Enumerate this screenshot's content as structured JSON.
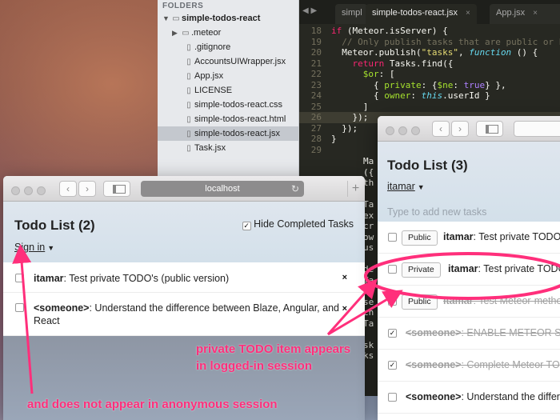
{
  "sidebar": {
    "header": "FOLDERS",
    "items": [
      {
        "label": "simple-todos-react",
        "type": "folder-open"
      },
      {
        "label": ".meteor",
        "type": "folder-closed"
      },
      {
        "label": ".gitignore",
        "type": "file"
      },
      {
        "label": "AccountsUIWrapper.jsx",
        "type": "file"
      },
      {
        "label": "App.jsx",
        "type": "file"
      },
      {
        "label": "LICENSE",
        "type": "file"
      },
      {
        "label": "simple-todos-react.css",
        "type": "file"
      },
      {
        "label": "simple-todos-react.html",
        "type": "file"
      },
      {
        "label": "simple-todos-react.jsx",
        "type": "file",
        "selected": true
      },
      {
        "label": "Task.jsx",
        "type": "file"
      }
    ]
  },
  "editor": {
    "tabs": [
      {
        "label": "simpl"
      },
      {
        "label": "simple-todos-react.jsx",
        "active": true
      },
      {
        "label": "App.jsx"
      }
    ],
    "close_glyph": "×",
    "lines": [
      {
        "n": "18",
        "code": "if (Meteor.isServer) {"
      },
      {
        "n": "19",
        "code": "  // Only publish tasks that are public or bel"
      },
      {
        "n": "20",
        "code": "  Meteor.publish(\"tasks\", function () {"
      },
      {
        "n": "21",
        "code": "    return Tasks.find({"
      },
      {
        "n": "22",
        "code": "      $or: ["
      },
      {
        "n": "23",
        "code": "        { private: {$ne: true} },"
      },
      {
        "n": "24",
        "code": "        { owner: this.userId }"
      },
      {
        "n": "25",
        "code": "      ]"
      },
      {
        "n": "26",
        "code": "    });"
      },
      {
        "n": "27",
        "code": "  });"
      },
      {
        "n": "28",
        "code": "}"
      },
      {
        "n": "29",
        "code": ""
      },
      {
        "n": "30",
        "code": "Meteor.meth"
      },
      {
        "n": "31",
        "code": "  addTask"
      }
    ],
    "fragments": [
      "Ma",
      "({",
      "th",
      "",
      "Ta",
      "ex",
      "cr",
      "ow",
      "us",
      "",
      "de",
      "Ta",
      "",
      "se",
      "ch",
      "Ta",
      "",
      "sk",
      "ks"
    ]
  },
  "left_window": {
    "url": "localhost",
    "title": "Todo List (2)",
    "login_label": "Sign in",
    "hide_completed_label": "Hide Completed Tasks",
    "hide_completed_checked": true,
    "tasks": [
      {
        "owner": "itamar",
        "text": ": Test private TODO's (public version)",
        "checked": false
      },
      {
        "owner": "<someone>",
        "text": ": Understand the difference between Blaze, Angular, and React",
        "checked": false
      }
    ],
    "delete_glyph": "×"
  },
  "right_window": {
    "title": "Todo List (3)",
    "login_label": "itamar",
    "new_task_placeholder": "Type to add new tasks",
    "tasks": [
      {
        "privacy_button": "Public",
        "owner": "itamar",
        "text": ": Test private TODO",
        "checked": false
      },
      {
        "privacy_button": "Private",
        "owner": "itamar",
        "text": ": Test private TODO",
        "checked": false
      },
      {
        "privacy_button": "Public",
        "owner": "itamar",
        "text": ": Test Meteor-metho",
        "checked": true
      },
      {
        "privacy_button": "",
        "owner": "<someone>",
        "text": ": ENABLE METEOR S",
        "checked": true
      },
      {
        "privacy_button": "",
        "owner": "<someone>",
        "text": ": Complete Meteor TO",
        "checked": true
      },
      {
        "privacy_button": "",
        "owner": "<someone>",
        "text": ": Understand the differ",
        "checked": false
      }
    ]
  },
  "annotations": {
    "line1": "private TODO item appears",
    "line2": "in logged-in session",
    "line3": "and does not appear in anonymous session",
    "color": "#ff2f7b"
  }
}
